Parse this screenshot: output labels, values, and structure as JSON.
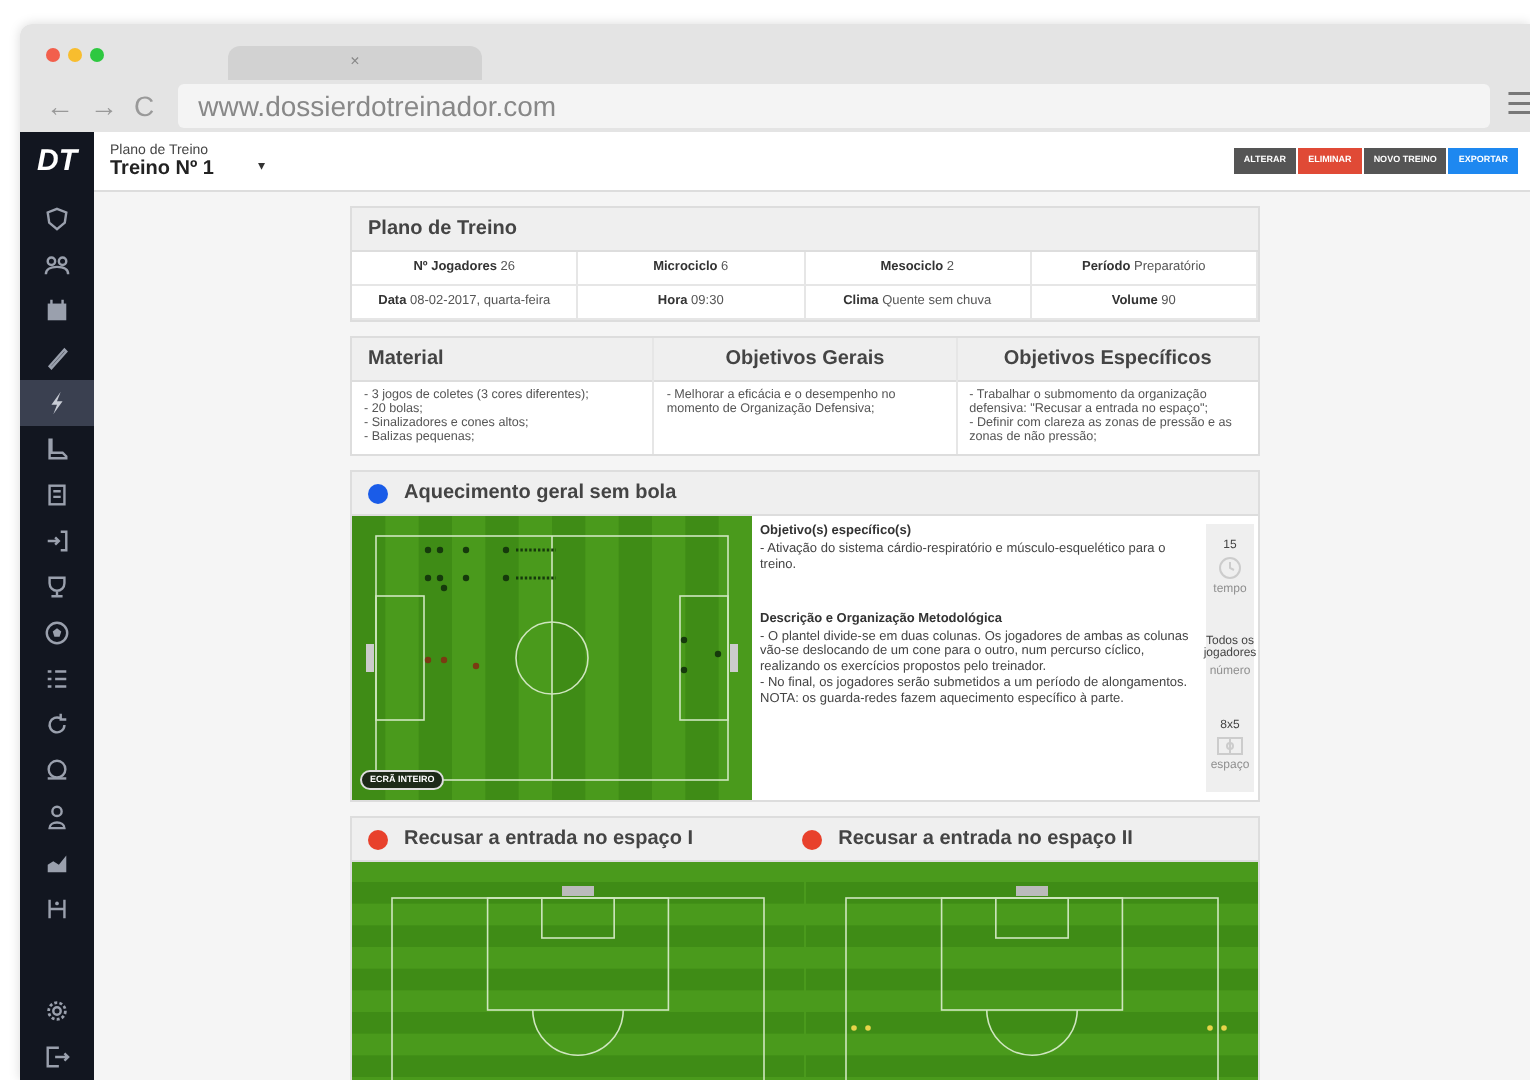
{
  "browser": {
    "tab_close": "×",
    "back": "←",
    "forward": "→",
    "reload": "C",
    "url": "www.dossierdotreinador.com",
    "menu": "☰"
  },
  "sidebar": {
    "logo": "DT",
    "items": [
      {
        "selected": false
      },
      {
        "selected": false
      },
      {
        "selected": false
      },
      {
        "selected": false
      },
      {
        "selected": true
      },
      {
        "selected": false
      },
      {
        "selected": false
      },
      {
        "selected": false
      },
      {
        "selected": false
      },
      {
        "selected": false
      },
      {
        "selected": false
      },
      {
        "selected": false
      },
      {
        "selected": false
      },
      {
        "selected": false
      },
      {
        "selected": false
      },
      {
        "selected": false
      }
    ],
    "bottom_items": [
      {
        "selected": false
      },
      {
        "selected": false
      }
    ]
  },
  "header": {
    "subtitle": "Plano de Treino",
    "title": "Treino Nº 1",
    "caret": "▾",
    "actions": [
      {
        "label": "ALTERAR",
        "color": "#555555"
      },
      {
        "label": "ELIMINAR",
        "color": "#e04a36"
      },
      {
        "label": "NOVO TREINO",
        "color": "#555555"
      },
      {
        "label": "EXPORTAR",
        "color": "#1e88f0"
      }
    ]
  },
  "plan": {
    "title": "Plano de Treino",
    "rows": [
      {
        "fields": [
          {
            "label": "Nº Jogadores",
            "value": "26"
          },
          {
            "label": "Microciclo",
            "value": "6"
          },
          {
            "label": "Mesociclo",
            "value": "2"
          },
          {
            "label": "Período",
            "value": "Preparatório"
          }
        ]
      },
      {
        "fields": [
          {
            "label": "Data",
            "value": "08-02-2017, quarta-feira"
          },
          {
            "label": "Hora",
            "value": "09:30"
          },
          {
            "label": "Clima",
            "value": "Quente sem chuva"
          },
          {
            "label": "Volume",
            "value": "90"
          }
        ]
      }
    ]
  },
  "objectives": {
    "columns": [
      {
        "title": "Material",
        "lines": [
          "- 3 jogos de coletes (3 cores diferentes);",
          "- 20 bolas;",
          "- Sinalizadores e cones altos;",
          "- Balizas pequenas;"
        ]
      },
      {
        "title": "Objetivos Gerais",
        "lines": [
          "- Melhorar a eficácia e o desempenho no momento de Organização Defensiva;"
        ]
      },
      {
        "title": "Objetivos Específicos",
        "lines": [
          "- Trabalhar o submomento da organização defensiva: \"Recusar a entrada no espaço\";",
          "- Definir com clareza as zonas de pressão e as zonas de não pressão;"
        ]
      }
    ]
  },
  "exercises": [
    {
      "kind": "full",
      "title": "Aquecimento geral sem bola",
      "color": "#1a5ce8",
      "fullscreen": "ECRÃ INTEIRO",
      "sections": [
        {
          "heading": "Objetivo(s) específico(s)",
          "lines": [
            "- Ativação do sistema cárdio-respiratório e músculo-esquelético para o treino."
          ]
        },
        {
          "heading": "Descrição e Organização Metodológica",
          "lines": [
            "- O plantel divide-se em duas colunas. Os jogadores de ambas as colunas vão-se deslocando de um cone para o outro, num percurso cíclico, realizando os exercícios propostos pelo treinador.",
            "- No final, os jogadores serão submetidos a um período de alongamentos.",
            "NOTA: os guarda-redes fazem aquecimento específico à parte."
          ]
        }
      ],
      "stats": [
        {
          "kind": "time",
          "value": "15",
          "label": "tempo"
        },
        {
          "kind": "count",
          "value": "Todos os jogadores",
          "label": "número"
        },
        {
          "kind": "area",
          "value": "8x5",
          "label": "espaço"
        }
      ]
    },
    {
      "kind": "compact",
      "title": "Recusar a entrada no espaço I",
      "color": "#e8412c"
    },
    {
      "kind": "compact",
      "title": "Recusar a entrada no espaço II",
      "color": "#e8412c",
      "cones": true
    }
  ]
}
